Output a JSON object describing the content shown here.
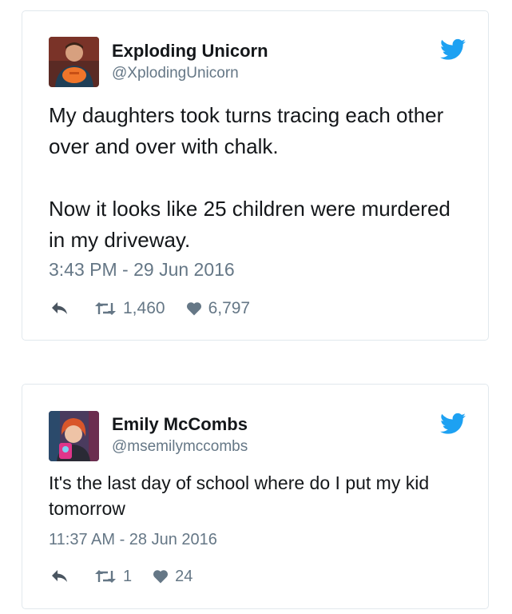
{
  "colors": {
    "twitter_blue": "#1da1f2",
    "secondary_text": "#657786",
    "card_border": "#e1e8ed"
  },
  "tweets": [
    {
      "name": "Exploding Unicorn",
      "handle": "@XplodingUnicorn",
      "text": "My daughters took turns tracing each other over and over with chalk.\n\nNow it looks like 25 children were murdered in my driveway.",
      "timestamp": "3:43 PM - 29 Jun 2016",
      "retweets": "1,460",
      "likes": "6,797",
      "icons": [
        "avatar",
        "twitter-bird-icon",
        "reply-icon",
        "retweet-icon",
        "heart-icon"
      ]
    },
    {
      "name": "Emily McCombs",
      "handle": "@msemilymccombs",
      "text": "It's the last day of school where do I put my kid tomorrow",
      "timestamp": "11:37 AM - 28 Jun 2016",
      "retweets": "1",
      "likes": "24",
      "icons": [
        "avatar",
        "twitter-bird-icon",
        "reply-icon",
        "retweet-icon",
        "heart-icon"
      ]
    }
  ]
}
